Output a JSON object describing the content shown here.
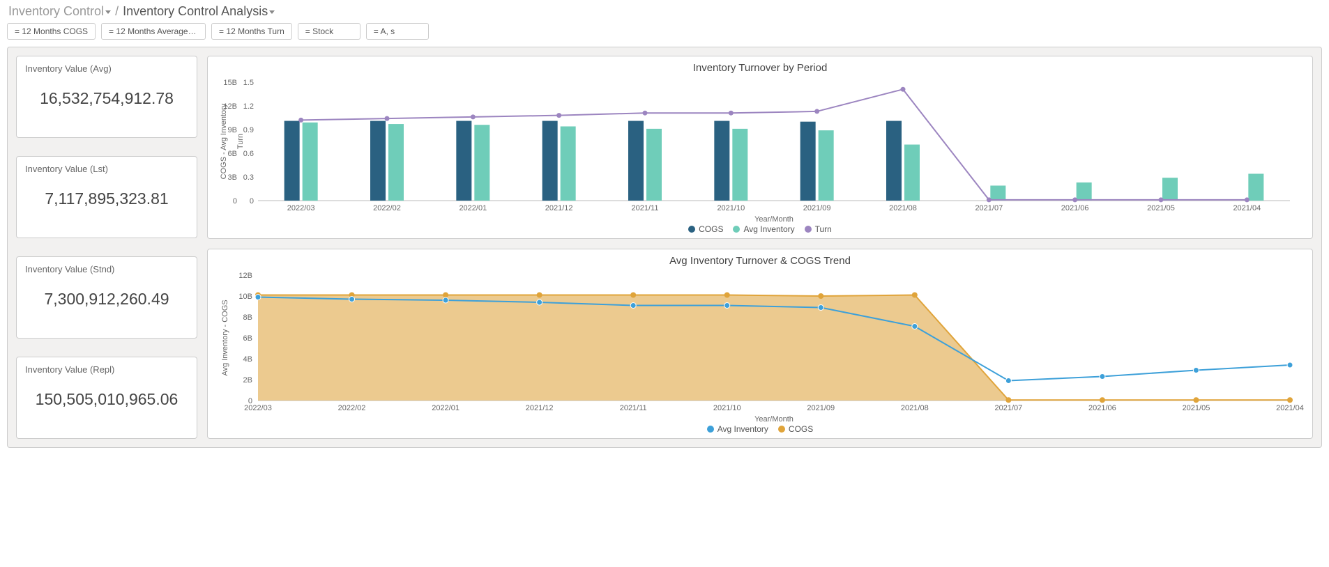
{
  "breadcrumb": {
    "part1": "Inventory Control",
    "separator": "/",
    "part2": "Inventory Control Analysis"
  },
  "filters": [
    "= 12 Months COGS",
    "= 12 Months Average I...",
    "= 12 Months Turn",
    "= Stock",
    "= A, s"
  ],
  "kpis": [
    {
      "label": "Inventory Value (Avg)",
      "value": "16,532,754,912.78"
    },
    {
      "label": "Inventory Value (Lst)",
      "value": "7,117,895,323.81"
    },
    {
      "label": "Inventory Value (Stnd)",
      "value": "7,300,912,260.49"
    },
    {
      "label": "Inventory Value (Repl)",
      "value": "150,505,010,965.06"
    }
  ],
  "chart1": {
    "title": "Inventory Turnover by Period",
    "xlabel": "Year/Month",
    "y1label": "COGS - Avg Inventory",
    "y2label": "Turn",
    "legend": [
      "COGS",
      "Avg Inventory",
      "Turn"
    ],
    "colors": {
      "cogs": "#2a6181",
      "avg_inventory": "#6fcdb9",
      "turn": "#9c85c0"
    }
  },
  "chart2": {
    "title": "Avg Inventory Turnover & COGS Trend",
    "xlabel": "Year/Month",
    "ylabel": "Avg Inventory - COGS",
    "legend": [
      "Avg Inventory",
      "COGS"
    ],
    "colors": {
      "avg_inventory": "#3da0d9",
      "cogs": "#e0a43a",
      "cogs_fill": "#e6b86a"
    }
  },
  "chart_data": [
    {
      "type": "bar",
      "title": "Inventory Turnover by Period",
      "xlabel": "Year/Month",
      "y1label": "COGS - Avg Inventory",
      "y2label": "Turn",
      "categories": [
        "2022/03",
        "2022/02",
        "2022/01",
        "2021/12",
        "2021/11",
        "2021/10",
        "2021/09",
        "2021/08",
        "2021/07",
        "2021/06",
        "2021/05",
        "2021/04"
      ],
      "y1_ticks": [
        "0",
        "3B",
        "6B",
        "9B",
        "12B",
        "15B"
      ],
      "y2_ticks": [
        "0",
        "0.3",
        "0.6",
        "0.9",
        "1.2",
        "1.5"
      ],
      "y1_range": [
        0,
        15
      ],
      "y2_range": [
        0,
        1.5
      ],
      "series": [
        {
          "name": "COGS",
          "axis": "y1",
          "type": "bar",
          "values": [
            10.1,
            10.1,
            10.1,
            10.1,
            10.1,
            10.1,
            10.0,
            10.1,
            0,
            0,
            0,
            0
          ]
        },
        {
          "name": "Avg Inventory",
          "axis": "y1",
          "type": "bar",
          "values": [
            9.9,
            9.7,
            9.6,
            9.4,
            9.1,
            9.1,
            8.9,
            7.1,
            1.9,
            2.3,
            2.9,
            3.4
          ]
        },
        {
          "name": "Turn",
          "axis": "y2",
          "type": "line",
          "values": [
            1.02,
            1.04,
            1.06,
            1.08,
            1.11,
            1.11,
            1.13,
            1.41,
            0.01,
            0.01,
            0.01,
            0.01
          ]
        }
      ]
    },
    {
      "type": "area",
      "title": "Avg Inventory Turnover & COGS Trend",
      "xlabel": "Year/Month",
      "ylabel": "Avg Inventory - COGS",
      "categories": [
        "2022/03",
        "2022/02",
        "2022/01",
        "2021/12",
        "2021/11",
        "2021/10",
        "2021/09",
        "2021/08",
        "2021/07",
        "2021/06",
        "2021/05",
        "2021/04"
      ],
      "y_ticks": [
        "0",
        "2B",
        "4B",
        "6B",
        "8B",
        "10B",
        "12B"
      ],
      "y_range": [
        0,
        12
      ],
      "series": [
        {
          "name": "COGS",
          "type": "area",
          "values": [
            10.1,
            10.1,
            10.1,
            10.1,
            10.1,
            10.1,
            10.0,
            10.1,
            0.05,
            0.05,
            0.05,
            0.05
          ]
        },
        {
          "name": "Avg Inventory",
          "type": "line",
          "values": [
            9.9,
            9.7,
            9.6,
            9.4,
            9.1,
            9.1,
            8.9,
            7.1,
            1.9,
            2.3,
            2.9,
            3.4
          ]
        }
      ]
    }
  ]
}
